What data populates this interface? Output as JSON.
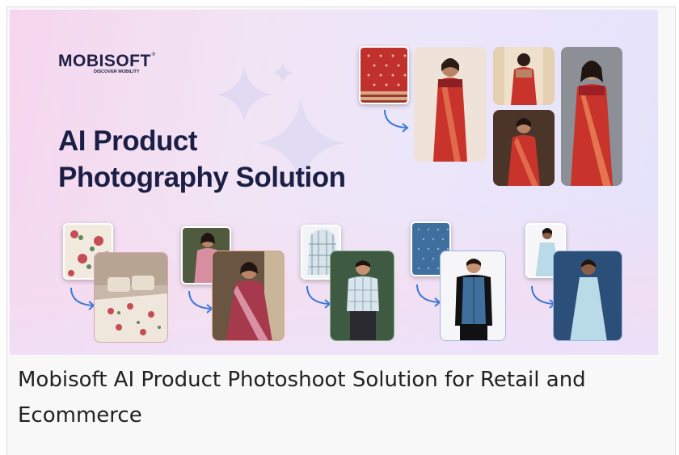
{
  "banner": {
    "logo": {
      "brand": "MOBISOFT",
      "tagline": "DISCOVER MOBILITY",
      "registered": "®"
    },
    "headline": {
      "line1": "AI Product",
      "line2": "Photography Solution"
    },
    "icons": {
      "arrow": "curved-arrow-icon",
      "sparkle": "sparkle-icon"
    },
    "colors": {
      "navy": "#1c1f45",
      "saree_red": "#c8342b",
      "accent_blue": "#3b78d6"
    }
  },
  "caption": {
    "text": "Mobisoft AI Product Photoshoot Solution for Retail and Ecommerce"
  }
}
